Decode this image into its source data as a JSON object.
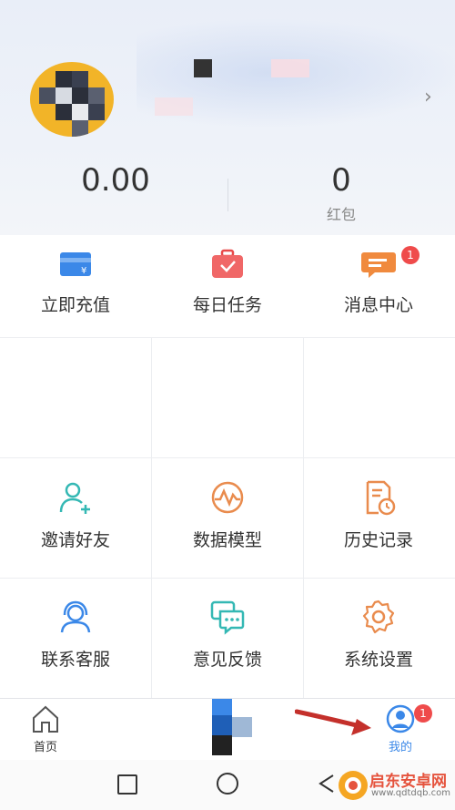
{
  "profile": {
    "balance": "0.00",
    "red_packet_count": "0",
    "red_packet_label": "红包"
  },
  "quick_actions": [
    {
      "label": "立即充值",
      "icon": "recharge-card-icon"
    },
    {
      "label": "每日任务",
      "icon": "task-bag-icon"
    },
    {
      "label": "消息中心",
      "icon": "message-icon",
      "badge": "1"
    }
  ],
  "menu": [
    {
      "label": "邀请好友",
      "icon": "invite-friend-icon"
    },
    {
      "label": "数据模型",
      "icon": "data-model-icon"
    },
    {
      "label": "历史记录",
      "icon": "history-icon"
    },
    {
      "label": "联系客服",
      "icon": "customer-service-icon"
    },
    {
      "label": "意见反馈",
      "icon": "feedback-icon"
    },
    {
      "label": "系统设置",
      "icon": "settings-icon"
    }
  ],
  "tabbar": {
    "home_label": "首页",
    "mine_label": "我的",
    "mine_badge": "1"
  },
  "watermark": {
    "brand": "启东安卓网",
    "url": "www.qdtdqb.com"
  },
  "colors": {
    "accent_blue": "#3b88e8",
    "icon_orange": "#e98b4d",
    "icon_teal": "#34b8b4",
    "badge_red": "#ef4b4b",
    "avatar_yellow": "#f2b428"
  }
}
